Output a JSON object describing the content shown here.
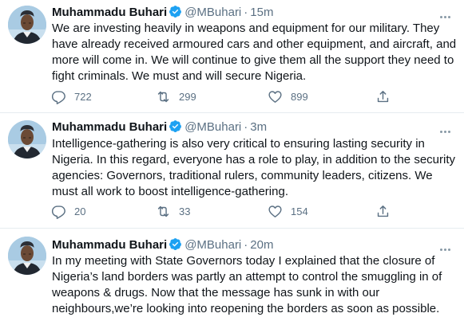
{
  "tweets": [
    {
      "name": "Muhammadu Buhari",
      "handle": "@MBuhari",
      "separator": "·",
      "time": "15m",
      "text": "We are investing heavily in weapons and equipment for our military. They have already received armoured cars and other equipment, and aircraft, and more will come in. We will continue to give them all the support they need to fight criminals. We must and will secure Nigeria.",
      "replies": "722",
      "retweets": "299",
      "likes": "899"
    },
    {
      "name": "Muhammadu Buhari",
      "handle": "@MBuhari",
      "separator": "·",
      "time": "3m",
      "text": "Intelligence-gathering is also very critical to ensuring lasting security in Nigeria. In this regard, everyone has a role to play, in addition to the security agencies: Governors, traditional rulers, community leaders, citizens. We must all work to boost intelligence-gathering.",
      "replies": "20",
      "retweets": "33",
      "likes": "154"
    },
    {
      "name": "Muhammadu Buhari",
      "handle": "@MBuhari",
      "separator": "·",
      "time": "20m",
      "text": "In my meeting with State Governors today I explained that the closure of Nigeria’s land borders was partly an attempt to control the smuggling in of weapons & drugs. Now that the message has sunk in with our neighbours,we’re looking into reopening the borders as soon as possible."
    }
  ],
  "icons": {
    "verified": "verified-badge-icon",
    "reply": "reply-icon",
    "retweet": "retweet-icon",
    "like": "heart-icon",
    "share": "share-icon",
    "more": "more-icon"
  },
  "colors": {
    "verified": "#1da1f2",
    "secondary_text": "#5b7083",
    "divider": "#e6ecf0"
  }
}
